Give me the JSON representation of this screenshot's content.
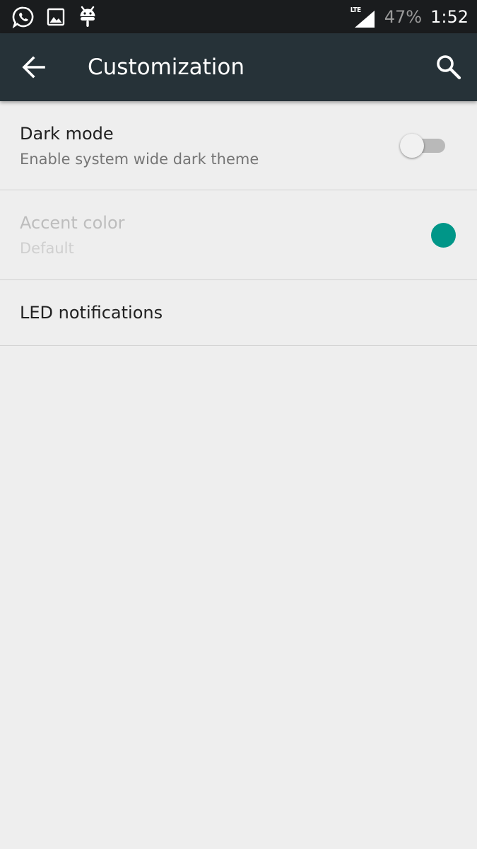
{
  "status_bar": {
    "network": "LTE",
    "battery": "47%",
    "time": "1:52",
    "notification_icons": [
      "whatsapp-icon",
      "image-icon",
      "android-debug-icon"
    ]
  },
  "toolbar": {
    "title": "Customization",
    "back_icon": "arrow-left-icon",
    "search_icon": "search-icon"
  },
  "settings": [
    {
      "title": "Dark mode",
      "summary": "Enable system wide dark theme",
      "control": "switch",
      "checked": false,
      "enabled": true
    },
    {
      "title": "Accent color",
      "summary": "Default",
      "control": "color-swatch",
      "color": "#009688",
      "enabled": false
    },
    {
      "title": "LED notifications",
      "enabled": true
    }
  ],
  "colors": {
    "toolbar": "#263238",
    "status_bar": "#1a1c1e",
    "background": "#eeeeee",
    "accent": "#009688"
  }
}
